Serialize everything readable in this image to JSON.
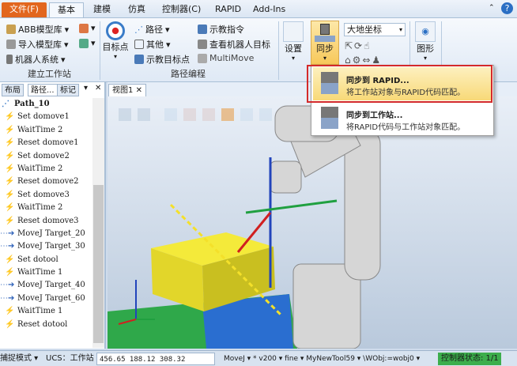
{
  "tabs": [
    {
      "label": "文件(F)"
    },
    {
      "label": "基本"
    },
    {
      "label": "建模"
    },
    {
      "label": "仿真"
    },
    {
      "label": "控制器(C)"
    },
    {
      "label": "RAPID"
    },
    {
      "label": "Add-Ins"
    }
  ],
  "ribbon": {
    "station": {
      "label": "建立工作站",
      "abb": "ABB模型库",
      "import": "导入模型库",
      "robot_sys": "机器人系统"
    },
    "path": {
      "label": "路径编程",
      "target": "目标点",
      "path": "路径",
      "other": "其他",
      "teach_target": "示教目标点",
      "teach_instr": "示教指令",
      "view_targets": "查看机器人目标",
      "multimove": "MultiMove"
    },
    "settings": "设置",
    "sync": "同步",
    "frame": "大地坐标",
    "graphics": "图形"
  },
  "menu": {
    "items": [
      {
        "title": "同步到 RAPID...",
        "desc": "将工作站对象与RAPID代码匹配。"
      },
      {
        "title": "同步到工作站...",
        "desc": "将RAPID代码与工作站对象匹配。"
      }
    ]
  },
  "left": {
    "tabs": [
      "布局",
      "路径...",
      "标记"
    ],
    "root": "Path_10",
    "items": [
      {
        "icon": "action",
        "text": "Set domove1"
      },
      {
        "icon": "action",
        "text": "WaitTime 2"
      },
      {
        "icon": "action",
        "text": "Reset domove1"
      },
      {
        "icon": "action",
        "text": "Set domove2"
      },
      {
        "icon": "action",
        "text": "WaitTime 2"
      },
      {
        "icon": "action",
        "text": "Reset domove2"
      },
      {
        "icon": "action",
        "text": "Set domove3"
      },
      {
        "icon": "action",
        "text": "WaitTime 2"
      },
      {
        "icon": "action",
        "text": "Reset domove3"
      },
      {
        "icon": "move",
        "text": "MoveJ Target_20"
      },
      {
        "icon": "move",
        "text": "MoveJ Target_30"
      },
      {
        "icon": "action",
        "text": "Set dotool"
      },
      {
        "icon": "action",
        "text": "WaitTime 1"
      },
      {
        "icon": "move",
        "text": "MoveJ Target_40"
      },
      {
        "icon": "move",
        "text": "MoveJ Target_60"
      },
      {
        "icon": "action",
        "text": "WaitTime 1"
      },
      {
        "icon": "action",
        "text": "Reset dotool"
      }
    ]
  },
  "view": {
    "tab": "视图1"
  },
  "status": {
    "snap": "捕捉模式",
    "ucs": "UCS：工作站",
    "coords": "456.65   188.12   308.32",
    "instr": "MoveJ ▾ * v200 ▾ fine ▾ MyNewTool59 ▾ \\WObj:=wobj0 ▾",
    "ctrl": "控制器状态:  1/1"
  }
}
